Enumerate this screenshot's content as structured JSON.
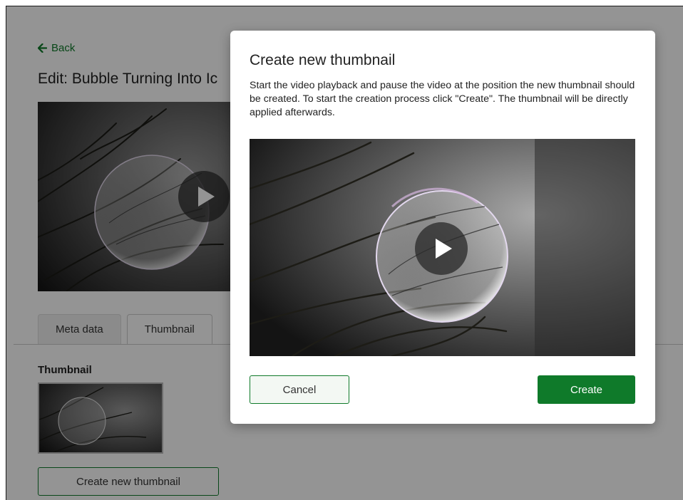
{
  "page": {
    "back_label": "Back",
    "edit_title": "Edit: Bubble Turning Into Ic",
    "tabs": [
      {
        "label": "Meta data"
      },
      {
        "label": "Thumbnail"
      }
    ],
    "thumbnail_section_label": "Thumbnail",
    "create_new_thumbnail_label": "Create new thumbnail"
  },
  "modal": {
    "title": "Create new thumbnail",
    "description": "Start the video playback and pause the video at the position the new thumbnail should be created. To start the creation process click \"Create\". The thumbnail will be directly applied afterwards.",
    "cancel_label": "Cancel",
    "create_label": "Create"
  },
  "colors": {
    "accent": "#0f7a2a",
    "overlay": "rgba(0,0,0,0.42)"
  },
  "icons": {
    "back": "arrow-left-icon",
    "play": "play-icon"
  }
}
